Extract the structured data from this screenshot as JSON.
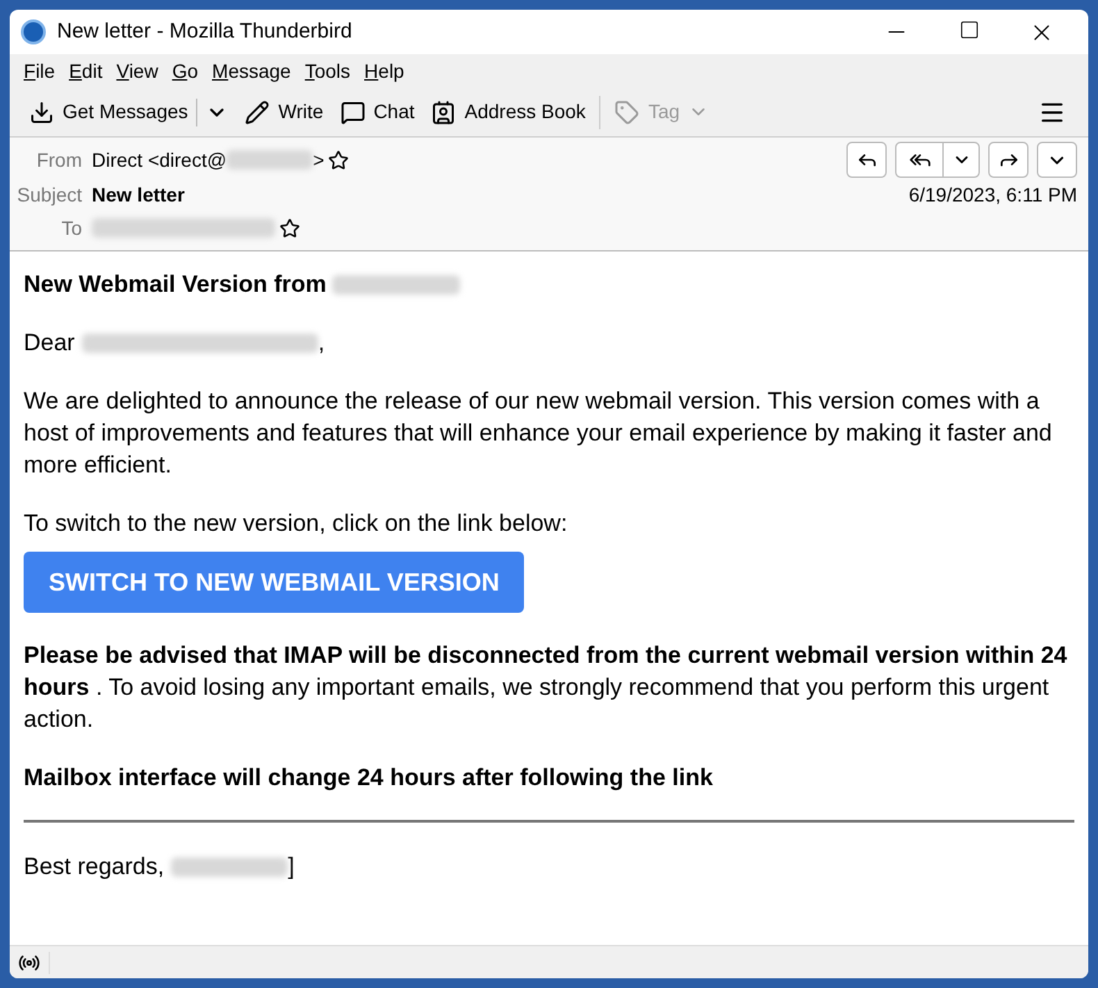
{
  "window": {
    "title": "New letter - Mozilla Thunderbird"
  },
  "menu": [
    "File",
    "Edit",
    "View",
    "Go",
    "Message",
    "Tools",
    "Help"
  ],
  "toolbar": [
    {
      "kind": "get",
      "label": "Get Messages",
      "disabled": false
    },
    {
      "kind": "write",
      "label": "Write",
      "disabled": false
    },
    {
      "kind": "chat",
      "label": "Chat",
      "disabled": false
    },
    {
      "kind": "address",
      "label": "Address Book",
      "disabled": false
    },
    {
      "kind": "tag",
      "label": "Tag",
      "disabled": true
    }
  ],
  "header": {
    "from_label": "From",
    "from_value": "Direct <direct@",
    "from_end": ">",
    "subject_label": "Subject",
    "subject": "New letter",
    "to_label": "To",
    "date": "6/19/2023, 6:11 PM"
  },
  "message": {
    "heading": "New Webmail Version  from",
    "greeting": "Dear",
    "greeting_end": ",",
    "intro": "We are delighted to announce the release of our new webmail version. This version comes with a host of improvements and features that will enhance your email experience by making it faster and more efficient.",
    "switch_text": "To switch to the new version, click on the link below:",
    "button": "SWITCH TO NEW WEBMAIL VERSION",
    "warning": "**Please be advised that IMAP will be disconnected from the current webmail version within 24 hours** . To avoid losing any important emails, we strongly recommend that you perform this urgent action.",
    "notice": "Mailbox interface will change 24 hours after following the link",
    "signoff": "Best regards,",
    "signoff_end": "]"
  }
}
